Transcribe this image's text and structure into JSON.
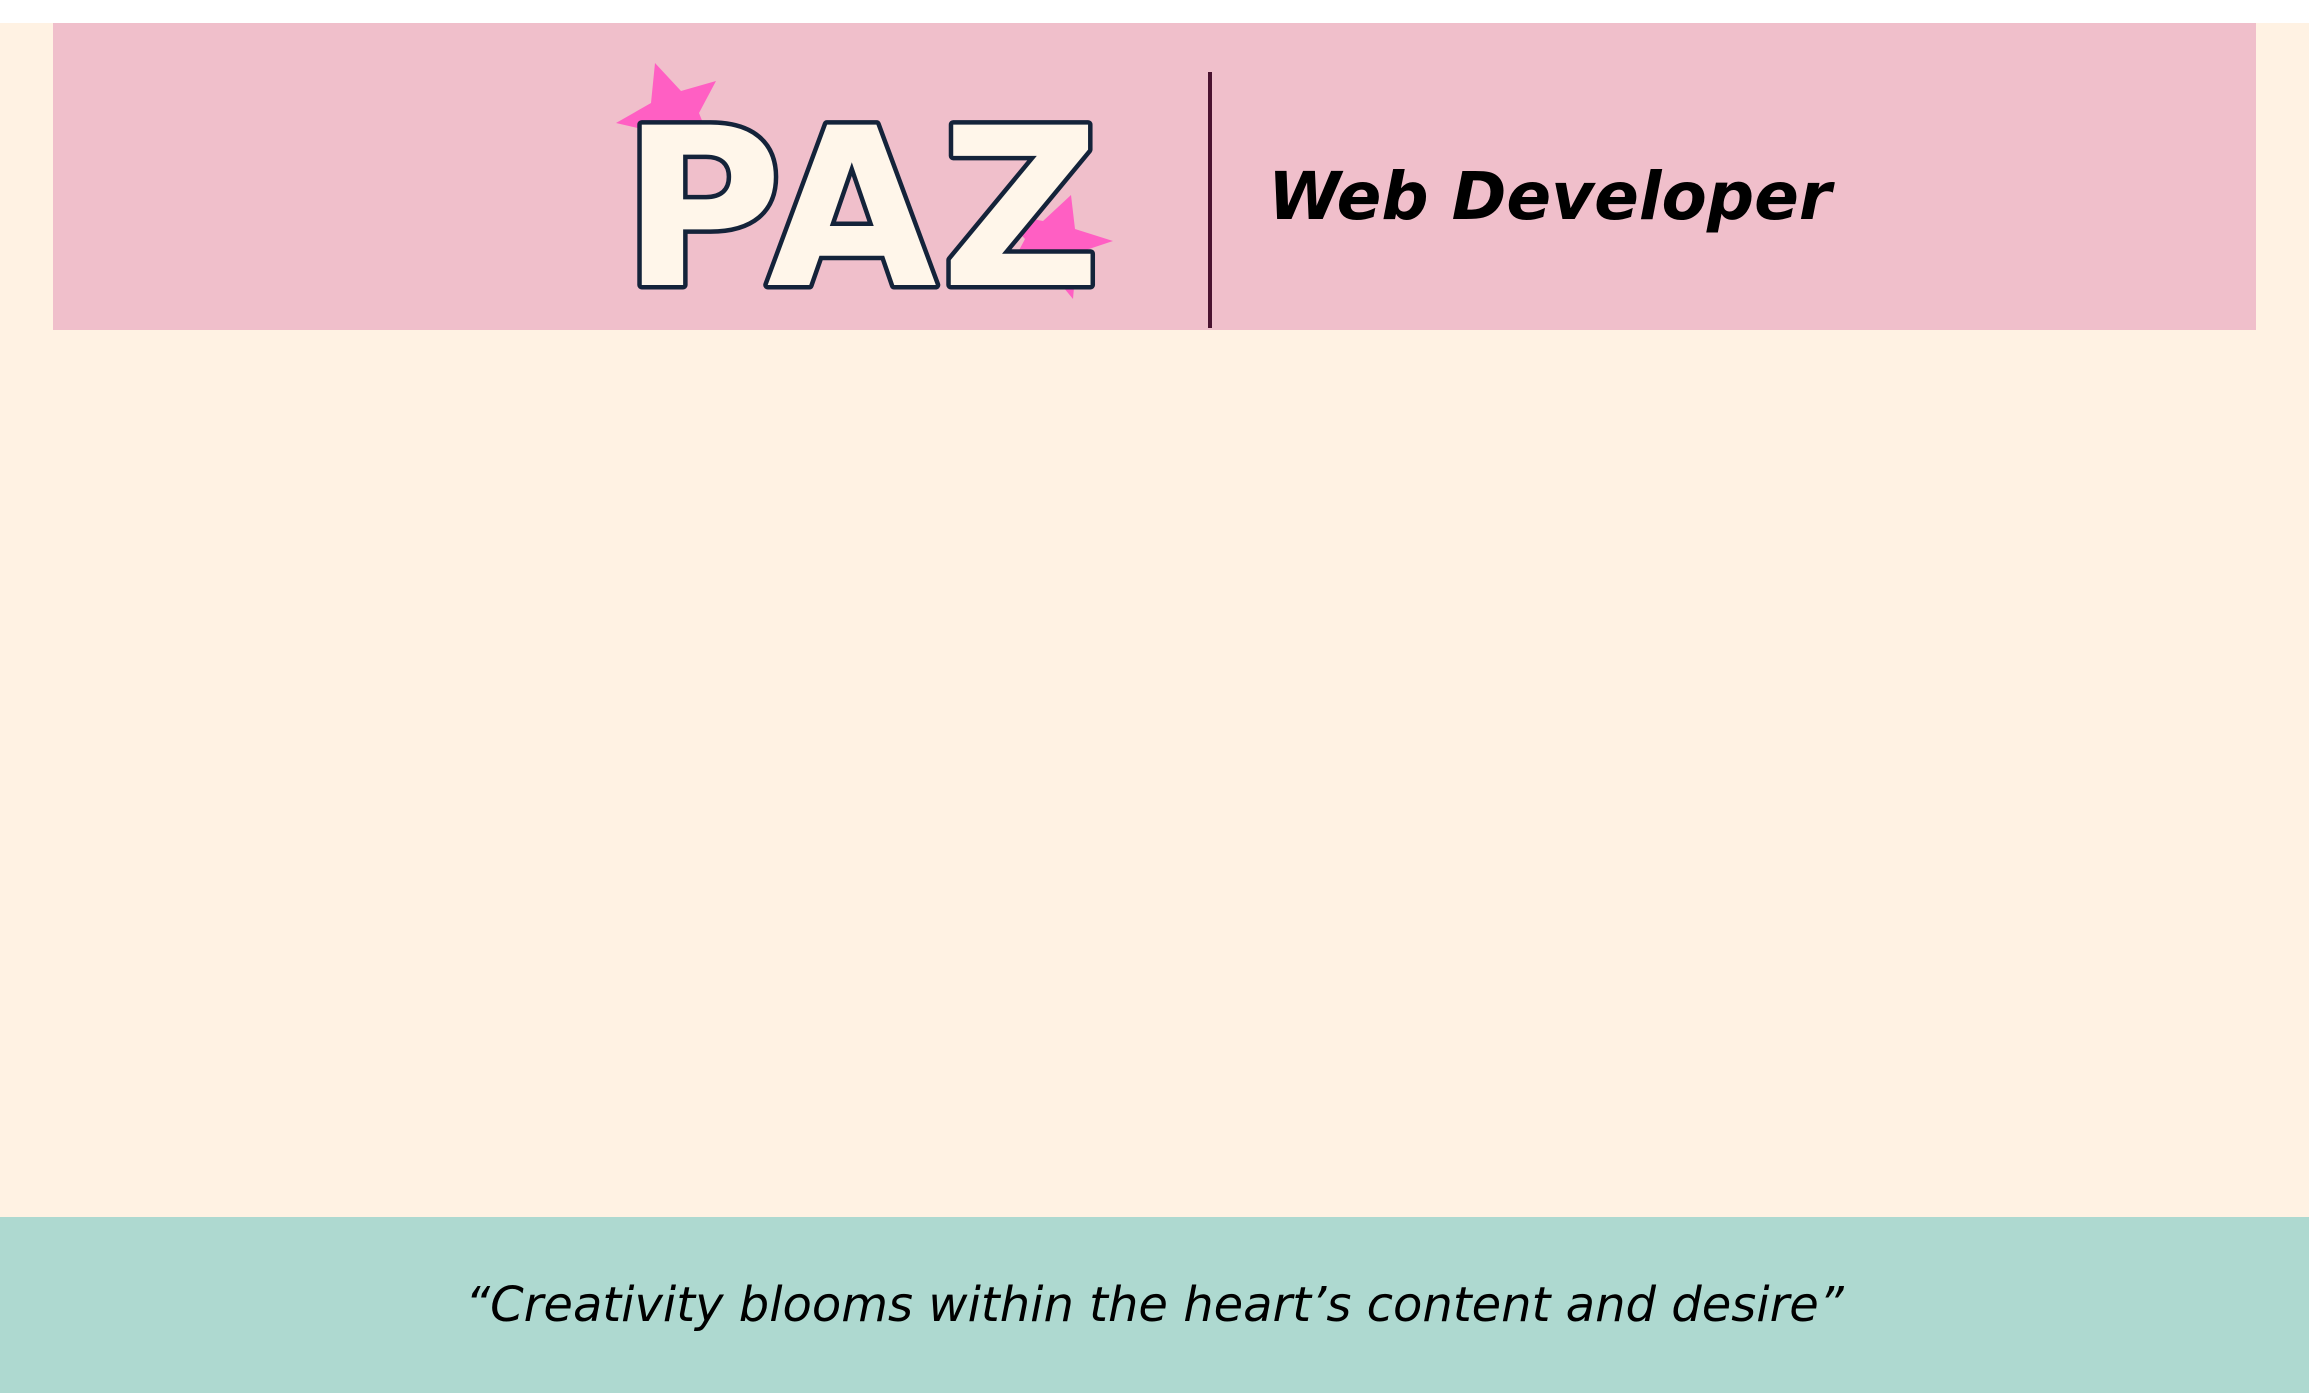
{
  "header": {
    "logo_text": "PAZ",
    "role_title": "Web Developer"
  },
  "footer": {
    "quote": "“Creativity blooms within the heart’s content and desire”"
  },
  "colors": {
    "header_bg": "#f0bfcb",
    "page_bg": "#fff2e3",
    "footer_bg": "#aed9d0",
    "star": "#ff5fc3",
    "logo_fill": "#fff6ea",
    "logo_outline": "#14233a",
    "divider": "#4a1230"
  }
}
